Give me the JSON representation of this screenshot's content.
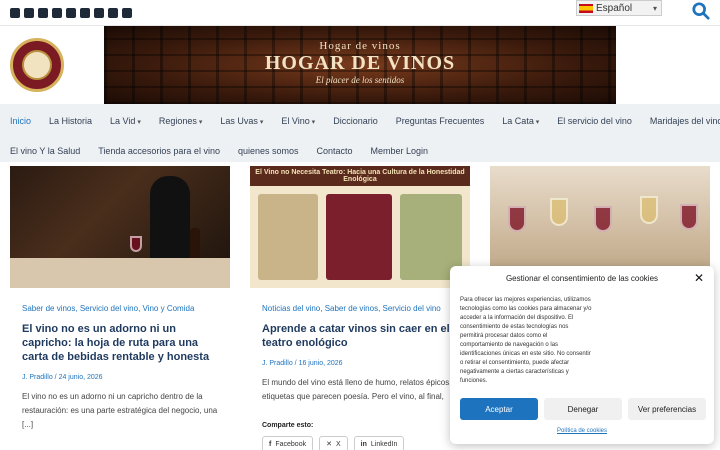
{
  "topbar": {
    "social_icons": [
      "facebook-icon",
      "twitter-icon",
      "instagram-icon",
      "youtube-icon",
      "tiktok-icon",
      "whatsapp-icon",
      "linkedin-icon",
      "telegram-icon",
      "pinterest-icon"
    ],
    "language": "Español"
  },
  "header": {
    "banner_small": "Hogar de vinos",
    "banner_big": "HOGAR DE VINOS",
    "banner_sub": "El placer de los sentidos"
  },
  "nav": {
    "row1": [
      "Inicio",
      "La Historia",
      "La Vid",
      "Regiones",
      "Las Uvas",
      "El Vino",
      "Diccionario",
      "Preguntas Frecuentes",
      "La Cata",
      "El servicio del vino",
      "Maridajes del vino"
    ],
    "row2": [
      "El vino Y la Salud",
      "Tienda accesorios para el vino",
      "quienes somos",
      "Contacto",
      "Member Login"
    ],
    "active": "Inicio"
  },
  "cards": [
    {
      "categories": "Saber de vinos, Servicio del vino, Vino y Comida",
      "title": "El vino no es un adorno ni un capricho: la hoja de ruta para una carta de bebidas rentable y honesta",
      "meta": "J. Pradillo / 24 junio, 2026",
      "excerpt": "El vino no es un adorno ni un capricho dentro de la restauración: es una parte estratégica del negocio, una [...]"
    },
    {
      "image_title": "El Vino no Necesita Teatro: Hacia una Cultura de la Honestidad Enológica",
      "categories": "Noticias del vino, Saber de vinos, Servicio del vino",
      "title": "Aprende a catar vinos sin caer en el teatro enológico",
      "meta": "J. Pradillo / 16 junio, 2026",
      "excerpt": "El mundo del vino está lleno de humo, relatos épicos y etiquetas que parecen poesía. Pero el vino, al final,"
    }
  ],
  "share": {
    "label": "Comparte esto:",
    "facebook": "Facebook",
    "x": "X",
    "linkedin": "LinkedIn"
  },
  "cookie": {
    "title": "Gestionar el consentimiento de las cookies",
    "body": "Para ofrecer las mejores experiencias, utilizamos tecnologías como las cookies para almacenar y/o acceder a la información del dispositivo. El consentimiento de estas tecnologías nos permitirá procesar datos como el comportamiento de navegación o las identificaciones únicas en este sitio. No consentir o retirar el consentimiento, puede afectar negativamente a ciertas características y funciones.",
    "accept": "Aceptar",
    "deny": "Denegar",
    "prefs": "Ver preferencias",
    "policy": "Política de cookies"
  },
  "colors": {
    "accent": "#1e73be",
    "nav_bg": "#eef1f4",
    "title": "#1f3a5f"
  }
}
